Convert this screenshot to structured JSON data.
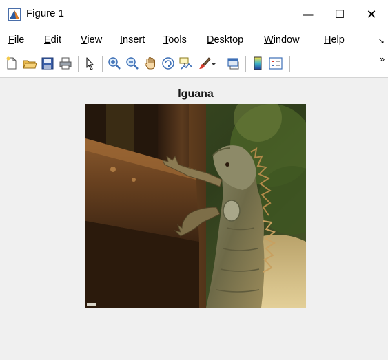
{
  "window": {
    "title": "Figure 1",
    "minimize": "—",
    "maximize": "☐",
    "close": "✕"
  },
  "menu": {
    "items": [
      {
        "acc": "F",
        "rest": "ile"
      },
      {
        "acc": "E",
        "rest": "dit"
      },
      {
        "acc": "V",
        "rest": "iew"
      },
      {
        "acc": "I",
        "rest": "nsert"
      },
      {
        "acc": "T",
        "rest": "ools"
      },
      {
        "acc": "D",
        "rest": "esktop"
      },
      {
        "acc": "W",
        "rest": "indow"
      },
      {
        "acc": "H",
        "rest": "elp"
      }
    ],
    "overflow": "↘"
  },
  "toolbar": {
    "buttons": [
      "new-figure-icon",
      "open-file-icon",
      "save-icon",
      "print-icon",
      "edit-plot-arrow-icon",
      "zoom-in-icon",
      "zoom-out-icon",
      "pan-hand-icon",
      "rotate-3d-icon",
      "data-cursor-icon",
      "brush-icon",
      "brush-dropdown-icon",
      "link-plot-icon",
      "insert-colorbar-icon",
      "insert-legend-icon"
    ],
    "more": "»"
  },
  "axes": {
    "title": "Iguana"
  },
  "colors": {
    "figure_background": "#f0f0f0",
    "window_background": "#ffffff"
  }
}
